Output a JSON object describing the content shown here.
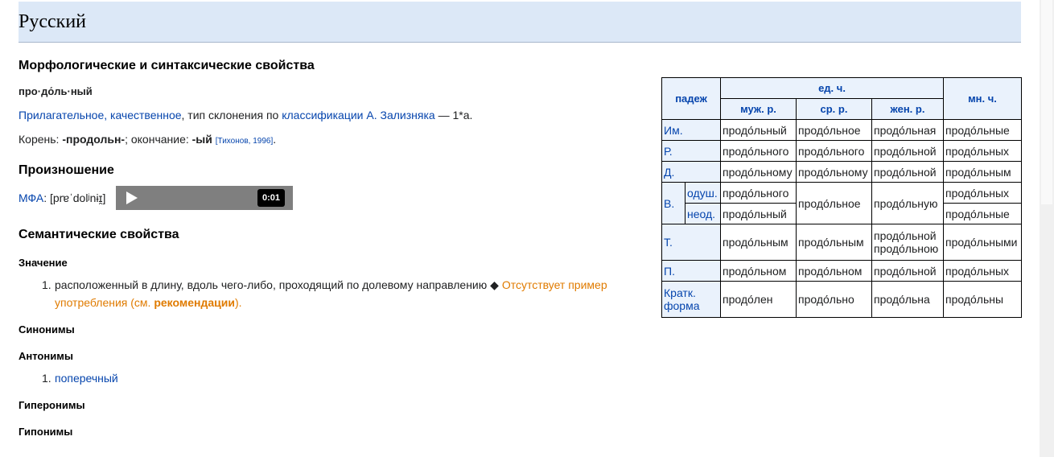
{
  "header": {
    "language": "Русский"
  },
  "morph": {
    "heading": "Морфологические и синтаксические свойства",
    "syllables": "про·до́ль·ный",
    "pos_link": "Прилагательное, качественное",
    "sep1": ", тип склонения по ",
    "class_link": "классификации А. Зализняка",
    "type_text": " — 1*a.",
    "root_label": "Корень: ",
    "root": "-продольн-",
    "ending_label": "; окончание: ",
    "ending": "-ый",
    "ref": "[Тихонов, 1996]",
    "period": "."
  },
  "pron": {
    "heading": "Произношение",
    "ipa_link": "МФА",
    "ipa_text": ": [prɐˈdolʲnɨɪ̯]",
    "audio_time": "0:01"
  },
  "semantic": {
    "heading": "Семантические свойства",
    "meaning_heading": "Значение",
    "meaning_num": "1.",
    "meaning_text": "расположенный в длину, вдоль чего-либо, проходящий по долевому направлению ◆ ",
    "missing_example": "Отсутствует пример",
    "missing_example2": "употребления (см. ",
    "recommend": "рекомендации",
    "close": ").",
    "synonyms_heading": "Синонимы",
    "antonyms_heading": "Антонимы",
    "antonym_num": "1.",
    "antonym": "поперечный",
    "hyperonyms_heading": "Гиперонимы",
    "hyponyms_heading": "Гипонимы"
  },
  "declension": {
    "case_header": "падеж",
    "singular": "ед. ч.",
    "plural": "мн. ч.",
    "masc": "муж. р.",
    "neut": "ср. р.",
    "fem": "жен. р.",
    "rows": {
      "nom": {
        "case": "Им.",
        "m": "продо́льный",
        "n": "продо́льное",
        "f": "продо́льная",
        "pl": "продо́льные"
      },
      "gen": {
        "case": "Р.",
        "m": "продо́льного",
        "n": "продо́льного",
        "f": "продо́льной",
        "pl": "продо́льных"
      },
      "dat": {
        "case": "Д.",
        "m": "продо́льному",
        "n": "продо́льному",
        "f": "продо́льной",
        "pl": "продо́льным"
      },
      "acc": {
        "case": "В.",
        "anim": "одуш.",
        "inan": "неод.",
        "m_anim": "продо́льного",
        "m_inan": "продо́льный",
        "n": "продо́льное",
        "f": "продо́льную",
        "pl_anim": "продо́льных",
        "pl_inan": "продо́льные"
      },
      "ins": {
        "case": "Т.",
        "m": "продо́льным",
        "n": "продо́льным",
        "f1": "продо́льной",
        "f2": "продо́льною",
        "pl": "продо́льными"
      },
      "pre": {
        "case": "П.",
        "m": "продо́льном",
        "n": "продо́льном",
        "f": "продо́льной",
        "pl": "продо́льных"
      },
      "short": {
        "case1": "Кратк.",
        "case2": "форма",
        "m": "продо́лен",
        "n": "продо́льно",
        "f": "продо́льна",
        "pl": "продо́льны"
      }
    }
  }
}
